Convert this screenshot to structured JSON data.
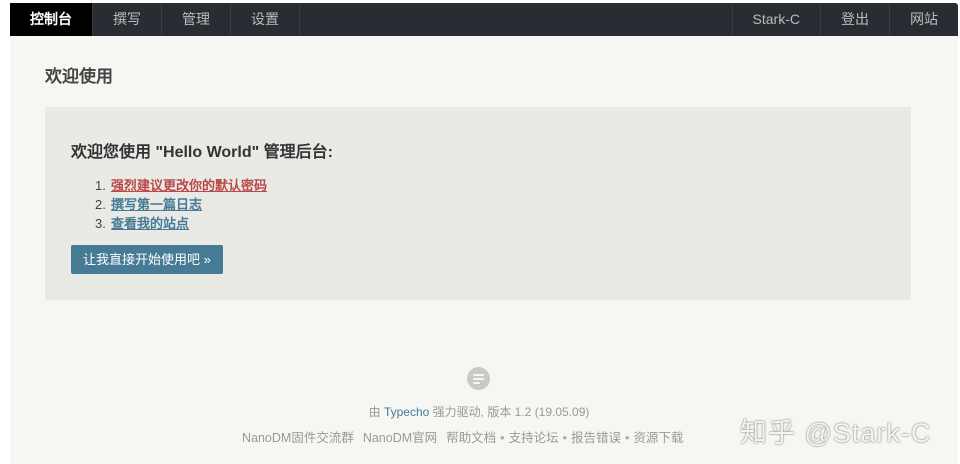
{
  "nav": {
    "left": [
      "控制台",
      "撰写",
      "管理",
      "设置"
    ],
    "right": [
      "Stark-C",
      "登出",
      "网站"
    ]
  },
  "page": {
    "title": "欢迎使用"
  },
  "welcome": {
    "heading": "欢迎您使用 \"Hello World\" 管理后台:",
    "steps": [
      {
        "num": "1.",
        "text": "强烈建议更改你的默认密码"
      },
      {
        "num": "2.",
        "text": "撰写第一篇日志"
      },
      {
        "num": "3.",
        "text": "查看我的站点"
      }
    ],
    "button": "让我直接开始使用吧 »"
  },
  "footer": {
    "powered_prefix": "由",
    "powered_brand": "Typecho",
    "powered_suffix": "强力驱动, 版本 1.2 (19.05.09)",
    "links": [
      "NanoDM固件交流群",
      "NanoDM官网",
      "帮助文档",
      "支持论坛",
      "报告错误",
      "资源下载"
    ],
    "separator": "•"
  },
  "watermark": "知乎 @Stark-C",
  "colors": {
    "nav_bg": "#292d33",
    "link_blue": "#467b96",
    "warn_red": "#b94a48",
    "panel_bg": "#e9e9e6"
  }
}
